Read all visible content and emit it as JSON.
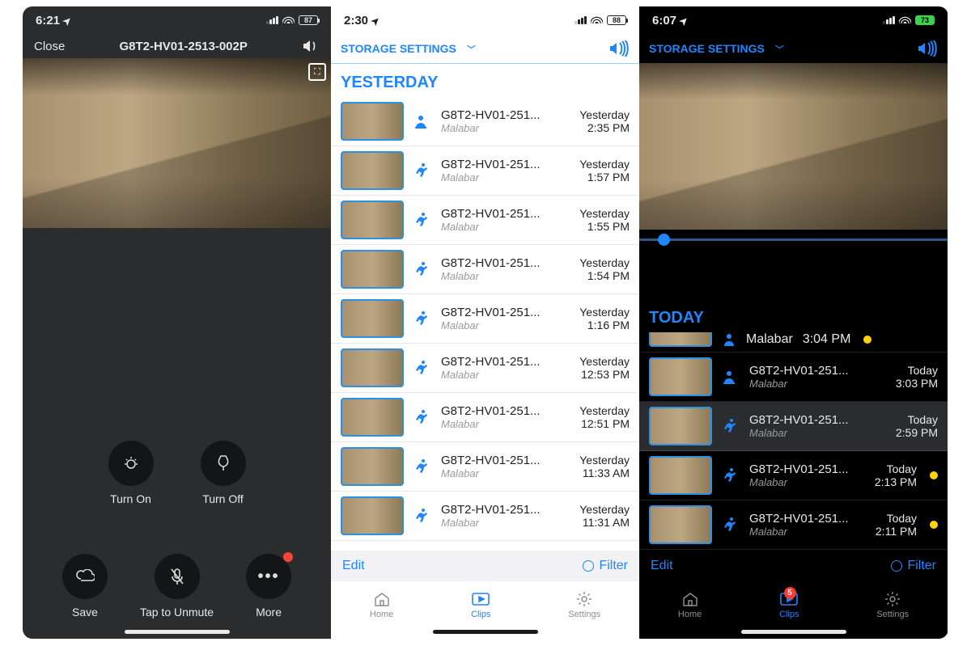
{
  "p1": {
    "time": "6:21",
    "battery": "87",
    "close": "Close",
    "title": "G8T2-HV01-2513-002P",
    "turn_on": "Turn On",
    "turn_off": "Turn Off",
    "save": "Save",
    "unmute": "Tap to Unmute",
    "more": "More"
  },
  "p2": {
    "time": "2:30",
    "battery": "88",
    "storage": "STORAGE SETTINGS",
    "section": "YESTERDAY",
    "edit": "Edit",
    "filter": "Filter",
    "tabs": {
      "home": "Home",
      "clips": "Clips",
      "settings": "Settings"
    },
    "clips": [
      {
        "icon": "person",
        "name": "G8T2-HV01-251...",
        "sub": "Malabar",
        "day": "Yesterday",
        "t": "2:35 PM"
      },
      {
        "icon": "motion",
        "name": "G8T2-HV01-251...",
        "sub": "Malabar",
        "day": "Yesterday",
        "t": "1:57 PM"
      },
      {
        "icon": "motion",
        "name": "G8T2-HV01-251...",
        "sub": "Malabar",
        "day": "Yesterday",
        "t": "1:55 PM"
      },
      {
        "icon": "motion",
        "name": "G8T2-HV01-251...",
        "sub": "Malabar",
        "day": "Yesterday",
        "t": "1:54 PM"
      },
      {
        "icon": "motion",
        "name": "G8T2-HV01-251...",
        "sub": "Malabar",
        "day": "Yesterday",
        "t": "1:16 PM"
      },
      {
        "icon": "motion",
        "name": "G8T2-HV01-251...",
        "sub": "Malabar",
        "day": "Yesterday",
        "t": "12:53 PM"
      },
      {
        "icon": "motion",
        "name": "G8T2-HV01-251...",
        "sub": "Malabar",
        "day": "Yesterday",
        "t": "12:51 PM"
      },
      {
        "icon": "motion",
        "name": "G8T2-HV01-251...",
        "sub": "Malabar",
        "day": "Yesterday",
        "t": "11:33 AM"
      },
      {
        "icon": "motion",
        "name": "G8T2-HV01-251...",
        "sub": "Malabar",
        "day": "Yesterday",
        "t": "11:31 AM"
      }
    ]
  },
  "p3": {
    "time": "6:07",
    "battery": "73",
    "storage": "STORAGE SETTINGS",
    "section": "TODAY",
    "edit": "Edit",
    "filter": "Filter",
    "tabs": {
      "home": "Home",
      "clips": "Clips",
      "settings": "Settings",
      "badge": "5"
    },
    "partial": {
      "sub": "Malabar",
      "t": "3:04 PM"
    },
    "clips": [
      {
        "icon": "person",
        "name": "G8T2-HV01-251...",
        "sub": "Malabar",
        "day": "Today",
        "t": "3:03 PM",
        "dot": false,
        "sel": false
      },
      {
        "icon": "motion",
        "name": "G8T2-HV01-251...",
        "sub": "Malabar",
        "day": "Today",
        "t": "2:59 PM",
        "dot": false,
        "sel": true
      },
      {
        "icon": "motion",
        "name": "G8T2-HV01-251...",
        "sub": "Malabar",
        "day": "Today",
        "t": "2:13 PM",
        "dot": true,
        "sel": false
      },
      {
        "icon": "motion",
        "name": "G8T2-HV01-251...",
        "sub": "Malabar",
        "day": "Today",
        "t": "2:11 PM",
        "dot": true,
        "sel": false
      }
    ]
  }
}
